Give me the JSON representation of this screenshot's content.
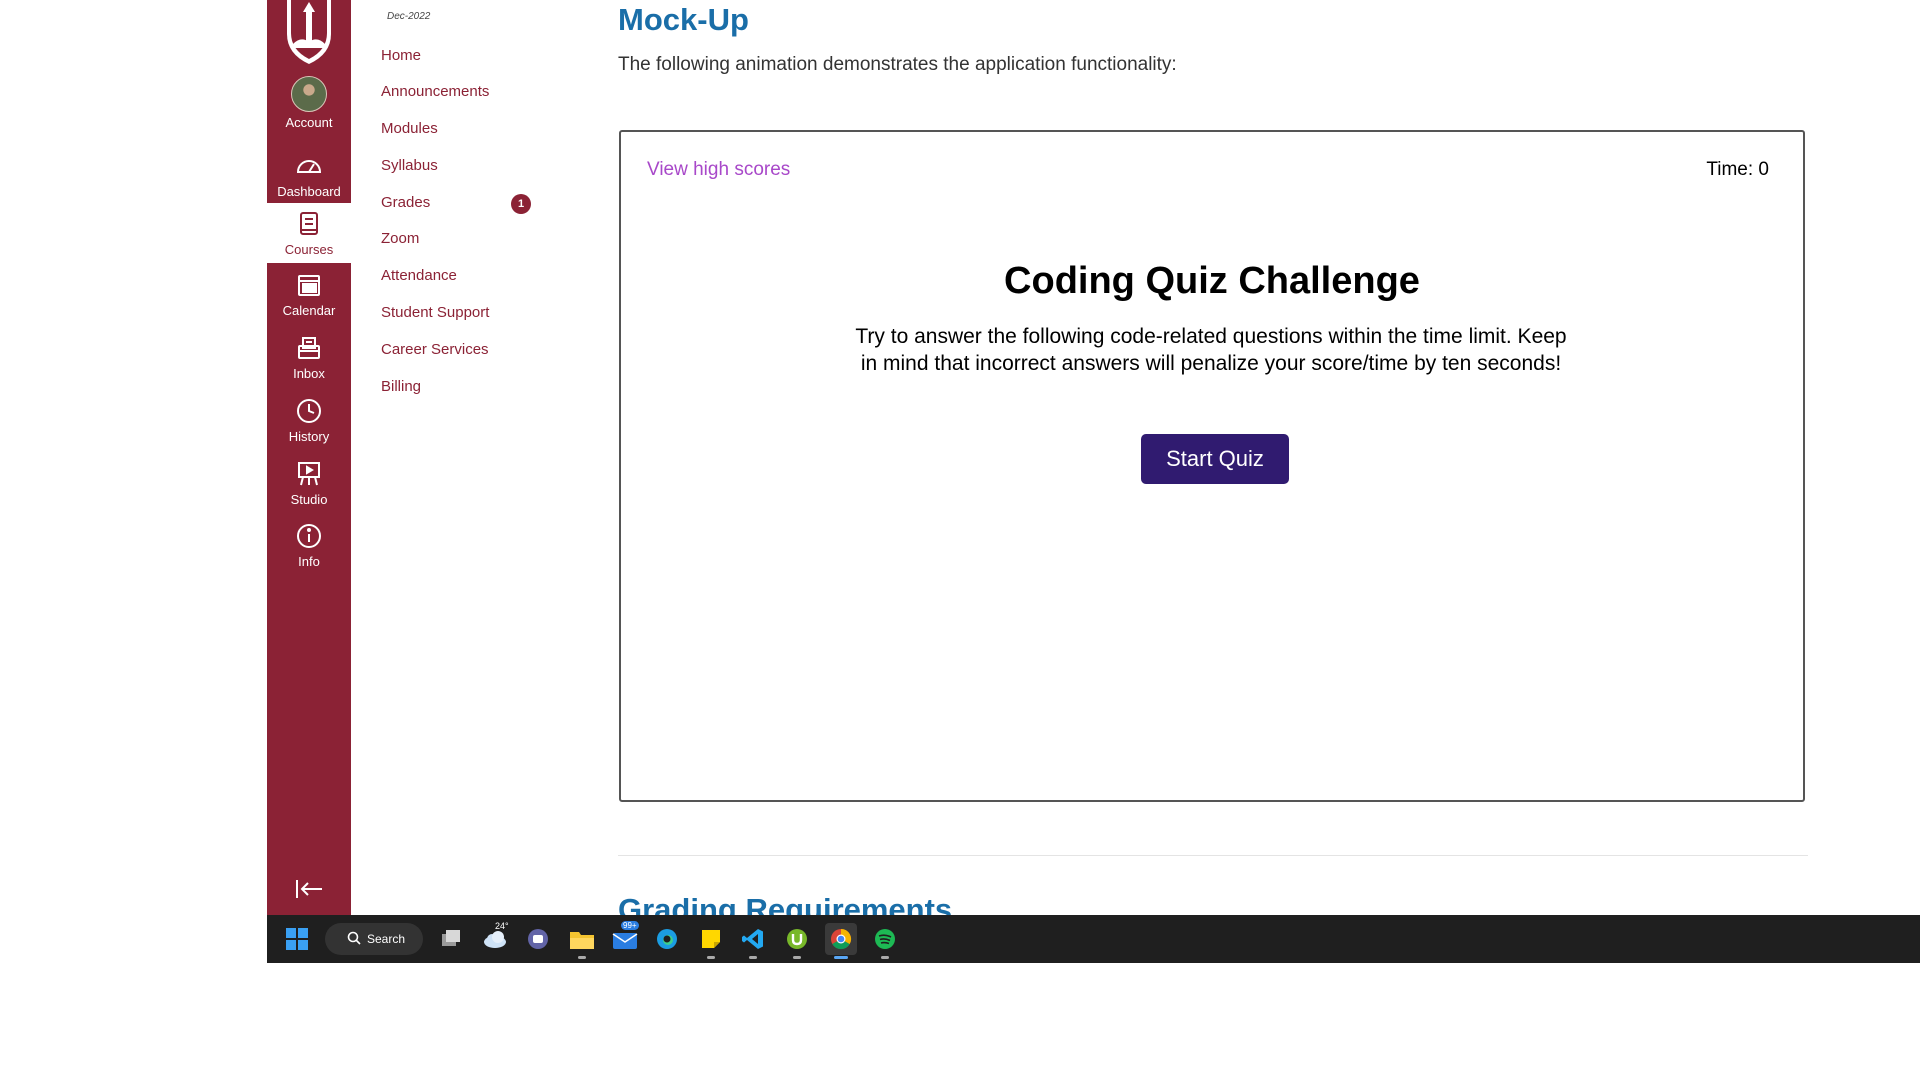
{
  "global_nav": {
    "items": [
      {
        "label": "Account",
        "icon": "avatar"
      },
      {
        "label": "Dashboard",
        "icon": "dashboard-icon"
      },
      {
        "label": "Courses",
        "icon": "courses-icon"
      },
      {
        "label": "Calendar",
        "icon": "calendar-icon"
      },
      {
        "label": "Inbox",
        "icon": "inbox-icon"
      },
      {
        "label": "History",
        "icon": "clock-icon"
      },
      {
        "label": "Studio",
        "icon": "studio-icon"
      },
      {
        "label": "Info",
        "icon": "info-icon"
      }
    ],
    "active": "Courses",
    "color": "#8b2235"
  },
  "course_nav": {
    "term": "Dec-2022",
    "items": [
      {
        "label": "Home"
      },
      {
        "label": "Announcements"
      },
      {
        "label": "Modules"
      },
      {
        "label": "Syllabus"
      },
      {
        "label": "Grades",
        "badge": "1"
      },
      {
        "label": "Zoom"
      },
      {
        "label": "Attendance"
      },
      {
        "label": "Student Support"
      },
      {
        "label": "Career Services"
      },
      {
        "label": "Billing"
      }
    ]
  },
  "content": {
    "heading": "Mock-Up",
    "intro": "The following animation demonstrates the application functionality:",
    "demo": {
      "high_scores_link": "View high scores",
      "timer": "Time: 0",
      "title": "Coding Quiz Challenge",
      "description": "Try to answer the following code-related questions within the time limit. Keep in mind that incorrect answers will penalize your score/time by ten seconds!",
      "start_button": "Start Quiz",
      "button_color": "#301b70"
    },
    "next_heading": "Grading Requirements"
  },
  "taskbar": {
    "search_label": "Search",
    "weather_temp": "24°",
    "mail_badge": "99+",
    "apps": [
      "windows-start-icon",
      "search-icon",
      "task-view-icon",
      "weather-icon",
      "teams-chat-icon",
      "file-explorer-icon",
      "mail-icon",
      "edge-icon",
      "sticky-notes-icon",
      "vscode-icon",
      "utorrent-icon",
      "chrome-icon",
      "spotify-icon"
    ]
  }
}
